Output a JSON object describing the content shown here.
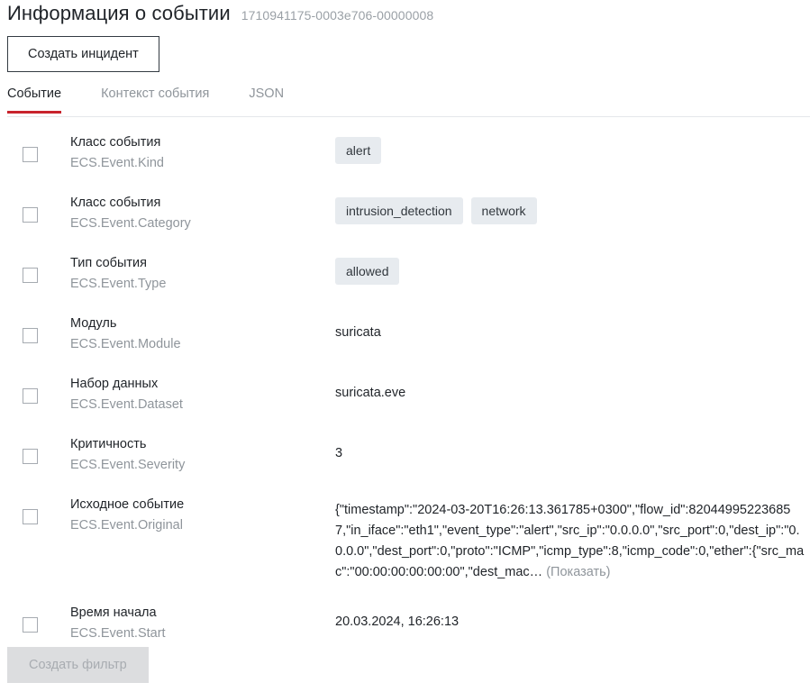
{
  "header": {
    "title": "Информация о событии",
    "event_id": "1710941175-0003e706-00000008"
  },
  "toolbar": {
    "create_incident_label": "Создать инцидент"
  },
  "tabs": [
    {
      "label": "Событие",
      "active": true
    },
    {
      "label": "Контекст события",
      "active": false
    },
    {
      "label": "JSON",
      "active": false
    }
  ],
  "fields": [
    {
      "label": "Класс события",
      "path": "ECS.Event.Kind",
      "type": "chips",
      "chips": [
        "alert"
      ]
    },
    {
      "label": "Класс события",
      "path": "ECS.Event.Category",
      "type": "chips",
      "chips": [
        "intrusion_detection",
        "network"
      ]
    },
    {
      "label": "Тип события",
      "path": "ECS.Event.Type",
      "type": "chips",
      "chips": [
        "allowed"
      ]
    },
    {
      "label": "Модуль",
      "path": "ECS.Event.Module",
      "type": "text",
      "value": "suricata"
    },
    {
      "label": "Набор данных",
      "path": "ECS.Event.Dataset",
      "type": "text",
      "value": "suricata.eve"
    },
    {
      "label": "Критичность",
      "path": "ECS.Event.Severity",
      "type": "text",
      "value": "3"
    },
    {
      "label": "Исходное событие",
      "path": "ECS.Event.Original",
      "type": "truncated",
      "value": "{\"timestamp\":\"2024-03-20T16:26:13.361785+0300\",\"flow_id\":820449952236857,\"in_iface\":\"eth1\",\"event_type\":\"alert\",\"src_ip\":\"0.0.0.0\",\"src_port\":0,\"dest_ip\":\"0.0.0.0\",\"dest_port\":0,\"proto\":\"ICMP\",\"icmp_type\":8,\"icmp_code\":0,\"ether\":{\"src_mac\":\"00:00:00:00:00:00\",\"dest_mac…",
      "show_more_label": "(Показать)"
    },
    {
      "label": "Время начала",
      "path": "ECS.Event.Start",
      "type": "text",
      "value": "20.03.2024, 16:26:13"
    }
  ],
  "footer": {
    "create_filter_label": "Создать фильтр"
  },
  "colors": {
    "accent": "#c8232c",
    "chip_bg": "#e7ebef",
    "muted_text": "#8f959b",
    "primary_text": "#1f2328",
    "divider": "#e4e7eb",
    "disabled_bg": "#dcdddf"
  }
}
